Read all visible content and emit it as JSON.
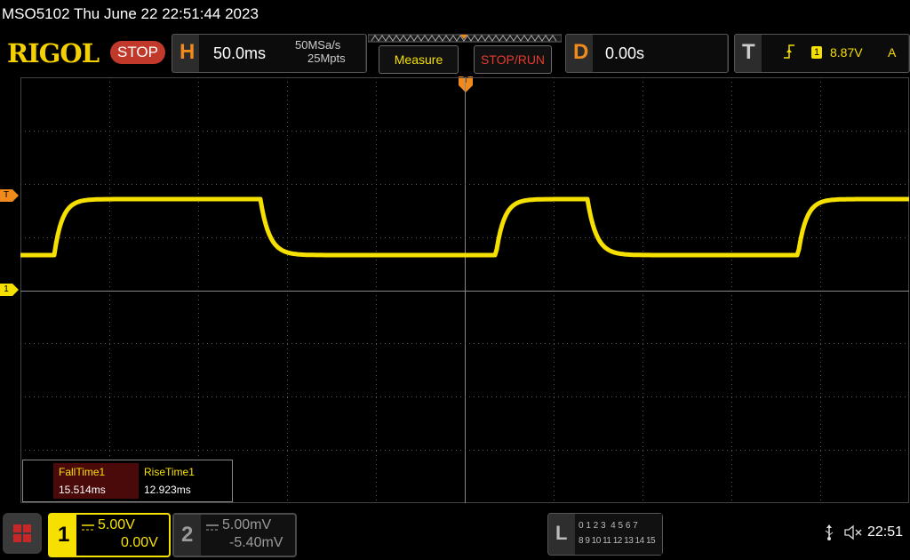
{
  "title_bar": {
    "text": "MSO5102  Thu June 22 22:51:44 2023"
  },
  "header": {
    "logo": "RIGOL",
    "run_state": "STOP",
    "horizontal": {
      "letter": "H",
      "timebase": "50.0ms",
      "sample_rate": "50MSa/s",
      "memory_depth": "25Mpts"
    },
    "measure_label": "Measure",
    "stoprun_label": "STOP/RUN",
    "delay": {
      "letter": "D",
      "value": "0.00s"
    },
    "trigger": {
      "letter": "T",
      "source": "1",
      "level": "8.87V",
      "mode": "A"
    }
  },
  "screen": {
    "trigger_marker": "T",
    "channel_marker": "1"
  },
  "measurements": {
    "items": [
      {
        "label": "FallTime1",
        "value": "15.514ms"
      },
      {
        "label": "RiseTime1",
        "value": "12.923ms"
      }
    ]
  },
  "channels": [
    {
      "number": "1",
      "scale": "5.00V",
      "offset": "0.00V",
      "color": "#f5e000"
    },
    {
      "number": "2",
      "scale": "5.00mV",
      "offset": "-5.40mV",
      "color": "#9a9a9a"
    }
  ],
  "logic": {
    "letter": "L",
    "row1": "0 1 2 3  4 5 6 7",
    "row2": "8 9 10 11 12 13 14 15"
  },
  "status": {
    "time": "22:51"
  },
  "colors": {
    "ch1": "#f5e000",
    "accent_orange": "#f08a1c",
    "stop_red": "#c0392b",
    "grid": "#5a5a5a"
  }
}
